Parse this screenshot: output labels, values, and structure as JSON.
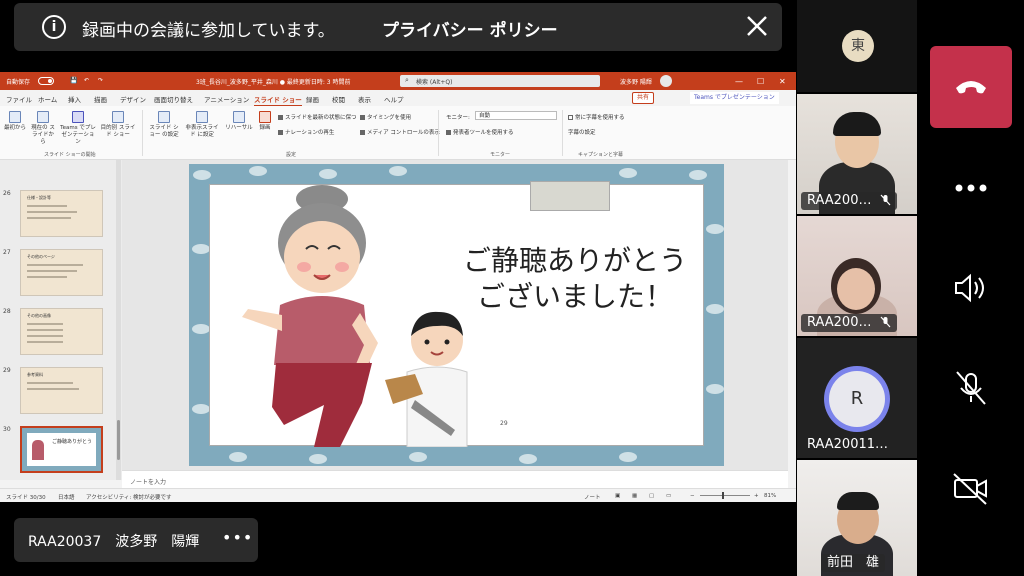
{
  "banner": {
    "message": "録画中の会議に参加しています。",
    "link": "プライバシー ポリシー"
  },
  "powerpoint": {
    "titlebar": {
      "autosave": "自動保存",
      "filename": "3班_長谷川_波多野_平井_森川 ● 最終更新日時: 3 時間前",
      "search_placeholder": "検索 (Alt+Q)",
      "user": "波多野 陽輝"
    },
    "menu": [
      "ファイル",
      "ホーム",
      "挿入",
      "描画",
      "デザイン",
      "画面切り替え",
      "アニメーション",
      "スライド ショー",
      "録画",
      "校閲",
      "表示",
      "ヘルプ"
    ],
    "active_menu": "スライド ショー",
    "share_label": "共有",
    "teams_label": "Teams でプレゼンテーション",
    "ribbon": {
      "btn_from_start": "最初から",
      "btn_from_current": "現在の スライドから",
      "btn_teams": "Teams でプレ ゼンテーション",
      "btn_custom": "目的別 スライド ショー",
      "btn_setup": "スライド ショー の設定",
      "btn_hide": "非表示スライド に設定",
      "btn_rehearse": "リハーサル",
      "btn_record": "録画",
      "chk_keep_fresh": "スライドを最新の状態に保つ",
      "chk_narration": "ナレーションの再生",
      "chk_timing": "タイミングを使用",
      "chk_media": "メディア コントロールの表示",
      "monitor_label": "モニター:",
      "monitor_value": "自動",
      "chk_presenter": "発表者ツールを使用する",
      "chk_subtitles": "常に字幕を使用する",
      "subtitle_settings": "字幕の設定",
      "group_start": "スライド ショーの開始",
      "group_settings": "設定",
      "group_monitor": "モニター",
      "group_captions": "キャプションと字幕"
    },
    "thumbnails": [
      {
        "num": "26",
        "title": "仕様・設計等"
      },
      {
        "num": "27",
        "title": "その他のページ"
      },
      {
        "num": "28",
        "title": "その他の画像"
      },
      {
        "num": "29",
        "title": "参考資料"
      },
      {
        "num": "30",
        "title": "ご静聴ありがとう"
      }
    ],
    "slide": {
      "line1": "ご静聴ありがとう",
      "line2": "ございました！",
      "page_number": "29"
    },
    "notes_placeholder": "ノートを入力",
    "status": {
      "slide_counter": "スライド 30/30",
      "language": "日本語",
      "accessibility": "アクセシビリティ: 検討が必要です",
      "notes": "ノート",
      "zoom": "81%"
    }
  },
  "presenter": {
    "name": "RAA20037　波多野　陽輝"
  },
  "participants": [
    {
      "name": "RAA200…",
      "muted": true
    },
    {
      "name": "RAA200…",
      "muted": true
    },
    {
      "name": "RAA20011…",
      "initial": "R"
    },
    {
      "name": "前田　雄"
    }
  ],
  "top_avatar_initial": "東",
  "colors": {
    "ppt_accent": "#c43e1c",
    "hangup": "#c4314b",
    "teams_purple": "#7b83eb"
  }
}
